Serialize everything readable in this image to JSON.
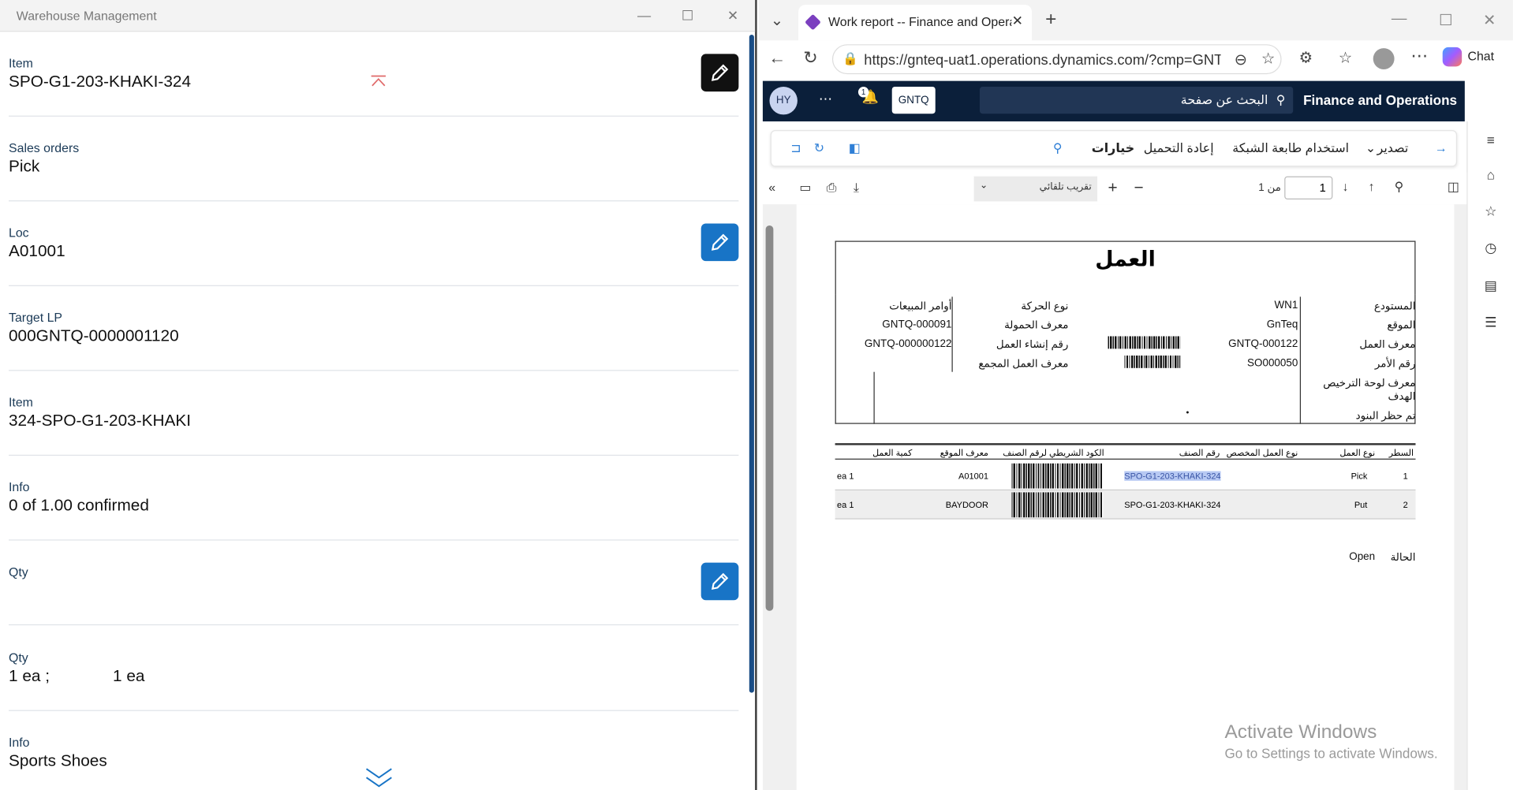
{
  "left_window": {
    "title": "Warehouse Management",
    "fields": [
      {
        "label": "Item",
        "value": "SPO-G1-203-KHAKI-324",
        "edit": "dark"
      },
      {
        "label": "Sales orders",
        "value": "Pick",
        "edit": "none"
      },
      {
        "label": "Loc",
        "value": "A01001",
        "edit": "blue"
      },
      {
        "label": "Target LP",
        "value": "000GNTQ-0000001120",
        "edit": "none"
      },
      {
        "label": "Item",
        "value": "324-SPO-G1-203-KHAKI",
        "edit": "none"
      },
      {
        "label": "Info",
        "value": "0 of 1.00 confirmed",
        "edit": "none"
      },
      {
        "label": "Qty",
        "value": "",
        "edit": "blue"
      },
      {
        "label": "Qty",
        "value": "1 ea ;",
        "value2": "1 ea",
        "edit": "none"
      },
      {
        "label": "Info",
        "value": "Sports Shoes",
        "edit": "none"
      }
    ]
  },
  "browser": {
    "tab_title": "Work report -- Finance and Operations",
    "url": "https://gnteq-uat1.operations.dynamics.com/?cmp=GNT...",
    "chat_label": "Chat",
    "app": {
      "brand": "Finance and Operations",
      "avatar": "HY",
      "company": "GNTQ",
      "notif_count": "1",
      "search_placeholder": "البحث عن صفحة"
    },
    "actions": {
      "export": "تصدير",
      "network_printer": "استخدام طابعة الشبكة",
      "reload": "إعادة التحميل",
      "options": "خيارات"
    },
    "pdf": {
      "zoom": "تقريب تلقائي",
      "page": "1",
      "of": "من 1"
    },
    "report": {
      "title": "العمل",
      "right_labels": [
        "المستودع",
        "الموقع",
        "معرف العمل",
        "رقم الأمر",
        "معرف لوحة الترخيص",
        "الهدف",
        "تم حظر البنود"
      ],
      "right_values": [
        "WN1",
        "GnTeq",
        "GNTQ-000122",
        "SO000050"
      ],
      "mid_labels": [
        "نوع الحركة",
        "معرف الحمولة",
        "رقم إنشاء العمل",
        "معرف العمل المجمع"
      ],
      "mid_values": [
        "أوامر المبيعات",
        "GNTQ-000091",
        "GNTQ-000000122"
      ],
      "dot": "•",
      "table_headers": [
        "السطر",
        "نوع العمل",
        "نوع العمل المخصص",
        "رقم الصنف",
        "الكود الشريطي لرقم الصنف",
        "معرف الموقع",
        "كمية العمل"
      ],
      "rows": [
        {
          "line": "1",
          "type": "Pick",
          "item": "SPO-G1-203-KHAKI-324",
          "loc": "A01001",
          "qty": "1 ea"
        },
        {
          "line": "2",
          "type": "Put",
          "item": "SPO-G1-203-KHAKI-324",
          "loc": "BAYDOOR",
          "qty": "1 ea"
        }
      ],
      "status_label": "الحالة",
      "status_value": "Open"
    }
  },
  "watermark": {
    "line1": "Activate Windows",
    "line2": "Go to Settings to activate Windows."
  }
}
